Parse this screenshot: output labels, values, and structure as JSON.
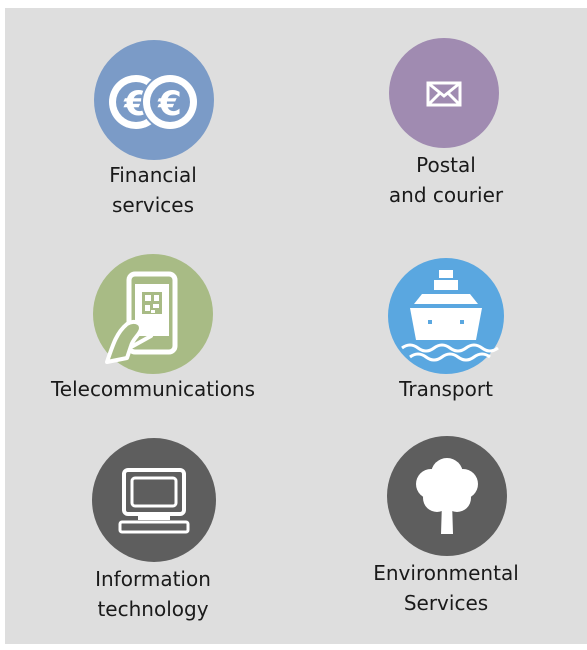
{
  "sectors": [
    {
      "label": "Financial\nservices",
      "icon": "euro-coins-icon",
      "color": "#7b9bc7"
    },
    {
      "label": "Postal\nand courier",
      "icon": "envelope-icon",
      "color": "#a08bb1"
    },
    {
      "label": "Telecommunications",
      "icon": "smartphone-qr-icon",
      "color": "#a8bb85"
    },
    {
      "label": "Transport",
      "icon": "ship-icon",
      "color": "#5aa7e0"
    },
    {
      "label": "Information\ntechnology",
      "icon": "computer-monitor-icon",
      "color": "#5e5e5e"
    },
    {
      "label": "Environmental\nServices",
      "icon": "tree-icon",
      "color": "#5e5e5e"
    }
  ]
}
